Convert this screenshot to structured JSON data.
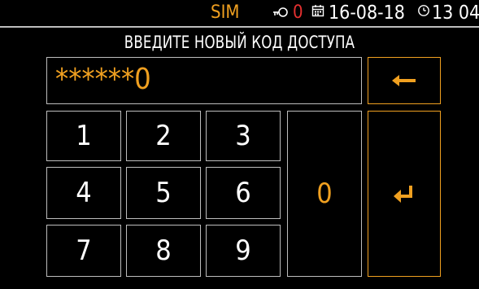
{
  "status_bar": {
    "sim": "SIM",
    "alarm_count": "0",
    "date": "16-08-18",
    "time": "13 04",
    "icons": [
      "key-icon",
      "calendar-icon",
      "clock-icon"
    ]
  },
  "title": "ВВЕДИТЕ НОВЫЙ КОД ДОСТУПА",
  "code_field": {
    "value": "******0"
  },
  "keypad": {
    "keys": [
      "1",
      "2",
      "3",
      "4",
      "5",
      "6",
      "7",
      "8",
      "9"
    ],
    "zero": "0",
    "backspace_icon": "arrow-left-icon",
    "enter_icon": "enter-arrow-icon"
  },
  "colors": {
    "accent": "#f0a020",
    "alarm": "#e53030",
    "border": "#bdbdbd",
    "background": "#000000"
  }
}
